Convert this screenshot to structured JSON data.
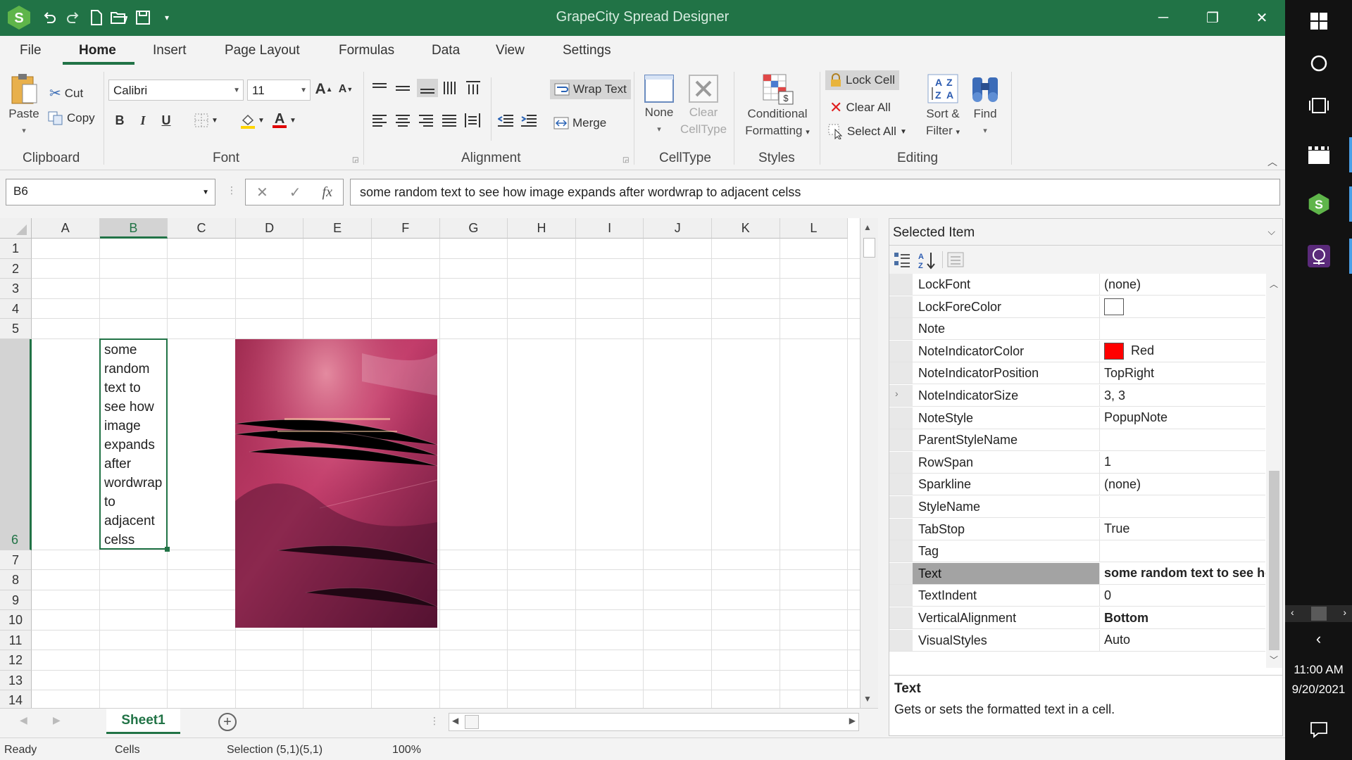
{
  "window": {
    "title": "GrapeCity Spread Designer",
    "minimize_glyph": "─",
    "restore_glyph": "❐",
    "close_glyph": "✕"
  },
  "menu": {
    "tabs": [
      {
        "label": "File"
      },
      {
        "label": "Home"
      },
      {
        "label": "Insert"
      },
      {
        "label": "Page Layout"
      },
      {
        "label": "Formulas"
      },
      {
        "label": "Data"
      },
      {
        "label": "View"
      },
      {
        "label": "Settings"
      }
    ],
    "active": "Home"
  },
  "ribbon": {
    "clipboard": {
      "label": "Clipboard",
      "paste": "Paste",
      "cut": "Cut",
      "copy": "Copy"
    },
    "font": {
      "label": "Font",
      "name": "Calibri",
      "size": "11",
      "bold": "B",
      "italic": "I",
      "underline": "U",
      "grow": "A",
      "shrink": "A",
      "color": "A"
    },
    "alignment": {
      "label": "Alignment",
      "wrap_text": "Wrap Text",
      "merge": "Merge"
    },
    "celltype": {
      "label": "CellType",
      "none": "None",
      "clear": "Clear",
      "clear2": "CellType"
    },
    "styles": {
      "label": "Styles",
      "cond1": "Conditional",
      "cond2": "Formatting"
    },
    "editing": {
      "label": "Editing",
      "lock_cell": "Lock Cell",
      "clear_all": "Clear All",
      "select_all": "Select All",
      "sort1": "Sort &",
      "sort2": "Filter",
      "find": "Find"
    }
  },
  "formula_bar": {
    "name_box": "B6",
    "fx": "fx",
    "cancel": "✕",
    "enter": "✓",
    "formula": "some random text to see how image expands after wordwrap to adjacent celss"
  },
  "sheet": {
    "columns": [
      "A",
      "B",
      "C",
      "D",
      "E",
      "F",
      "G",
      "H",
      "I",
      "J",
      "K",
      "L"
    ],
    "rows": [
      "1",
      "2",
      "3",
      "4",
      "5",
      "6",
      "7",
      "8",
      "9",
      "10",
      "11",
      "12",
      "13",
      "14"
    ],
    "selected_col": "B",
    "selected_row": "6",
    "b6_text": "some random text to see how image expands after wordwrap to adjacent celss",
    "tab": "Sheet1"
  },
  "status": {
    "ready": "Ready",
    "mode": "Cells",
    "selection": "Selection (5,1)(5,1)",
    "zoom": "100%"
  },
  "property_panel": {
    "header": "Selected Item",
    "rows": [
      {
        "name": "LockFont",
        "value": "(none)"
      },
      {
        "name": "LockForeColor",
        "value": "",
        "swatch": "#ffffff"
      },
      {
        "name": "Note",
        "value": ""
      },
      {
        "name": "NoteIndicatorColor",
        "value": "Red",
        "swatch": "#ff0000"
      },
      {
        "name": "NoteIndicatorPosition",
        "value": "TopRight"
      },
      {
        "name": "NoteIndicatorSize",
        "value": "3, 3"
      },
      {
        "name": "NoteStyle",
        "value": "PopupNote"
      },
      {
        "name": "ParentStyleName",
        "value": ""
      },
      {
        "name": "RowSpan",
        "value": "1"
      },
      {
        "name": "Sparkline",
        "value": "(none)"
      },
      {
        "name": "StyleName",
        "value": ""
      },
      {
        "name": "TabStop",
        "value": "True"
      },
      {
        "name": "Tag",
        "value": ""
      },
      {
        "name": "Text",
        "value": "some random text to see ho",
        "highlighted": true,
        "bold": true
      },
      {
        "name": "TextIndent",
        "value": "0"
      },
      {
        "name": "VerticalAlignment",
        "value": "Bottom",
        "bold": true
      },
      {
        "name": "VisualStyles",
        "value": "Auto"
      }
    ],
    "desc_title": "Text",
    "desc_text": "Gets or sets the formatted text in a cell."
  },
  "taskbar": {
    "time": "11:00 AM",
    "date": "9/20/2021"
  },
  "colors": {
    "accent": "#217346",
    "title_bar": "#217346",
    "taskbar": "#121212"
  }
}
